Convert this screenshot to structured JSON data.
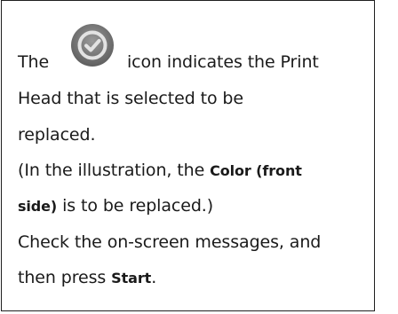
{
  "note": {
    "line1_before_icon": "The",
    "icon_name": "selected-check-icon",
    "line1_after_icon": "icon indicates the Print",
    "line2": "Head that is selected to be",
    "line3": "replaced.",
    "line4": "(In the illustration, the",
    "line4_bold": "Color (front",
    "line5_bold": "side)",
    "line5_after": "is to be replaced.)",
    "line6": "Check the on-screen messages, and",
    "line7_before": "then press",
    "line7_bold": "Start",
    "line7_after": "."
  },
  "colors": {
    "border": "#1f1f1f",
    "text": "#1a1a1a",
    "icon_fill": "#7a7a7a",
    "icon_ring": "#d9d9d9"
  }
}
